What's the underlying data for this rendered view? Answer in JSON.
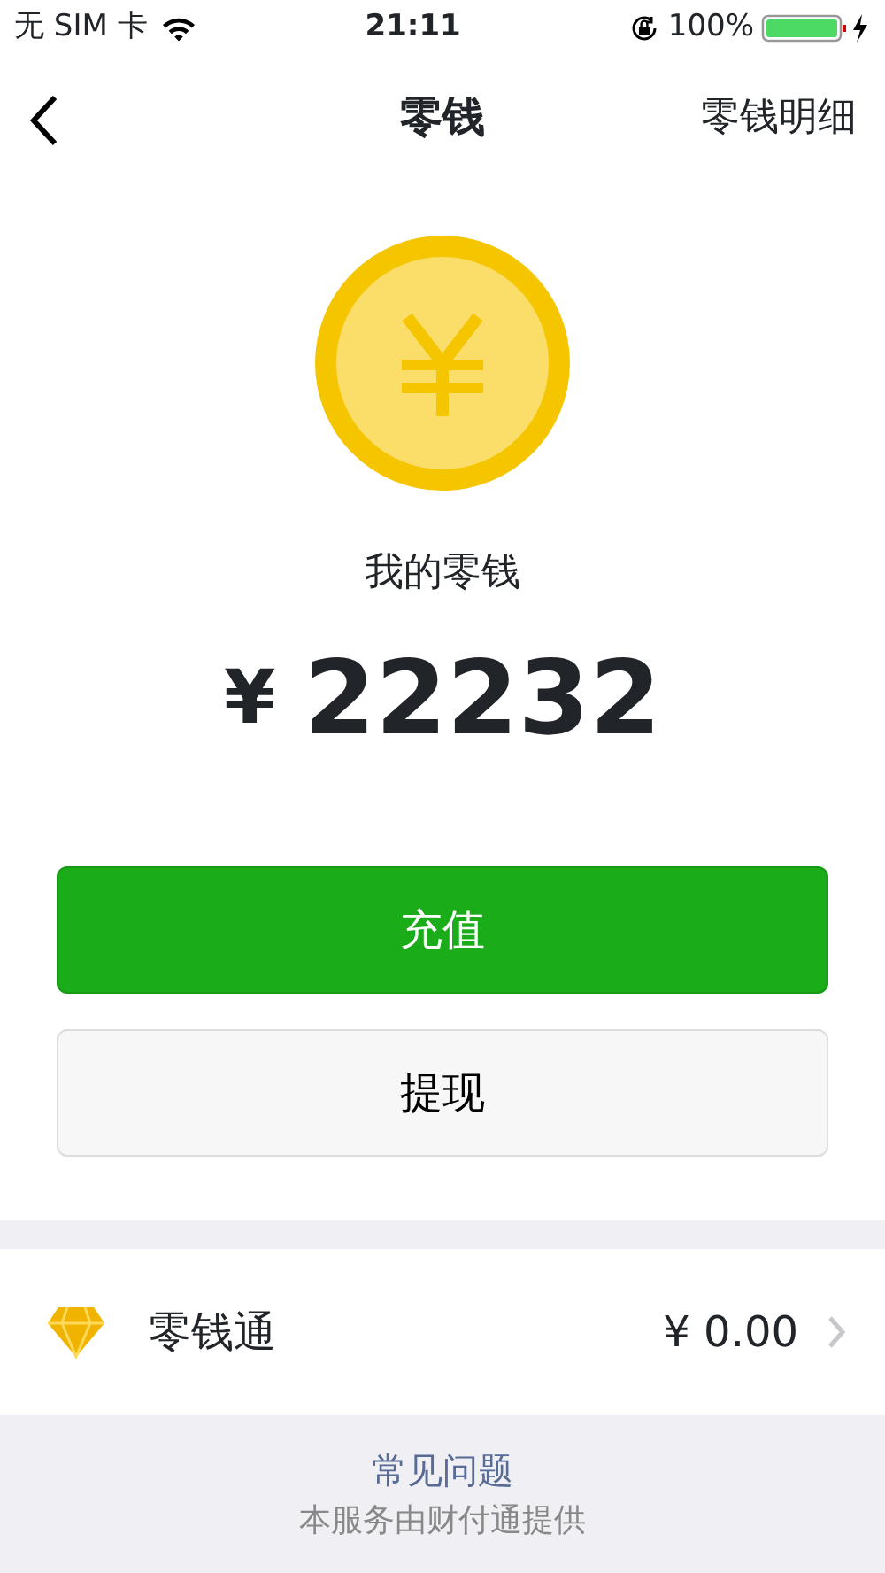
{
  "status_bar": {
    "carrier": "无 SIM 卡",
    "time": "21:11",
    "battery": "100%"
  },
  "nav": {
    "title": "零钱",
    "action": "零钱明细"
  },
  "balance": {
    "label": "我的零钱",
    "currency": "¥",
    "amount": "22232"
  },
  "buttons": [
    {
      "label": "充值",
      "kind": "primary"
    },
    {
      "label": "提现",
      "kind": "secondary"
    }
  ],
  "list": [
    {
      "label": "零钱通",
      "value": "¥ 0.00"
    }
  ],
  "footer": {
    "link": "常见问题",
    "note": "本服务由财付通提供"
  }
}
